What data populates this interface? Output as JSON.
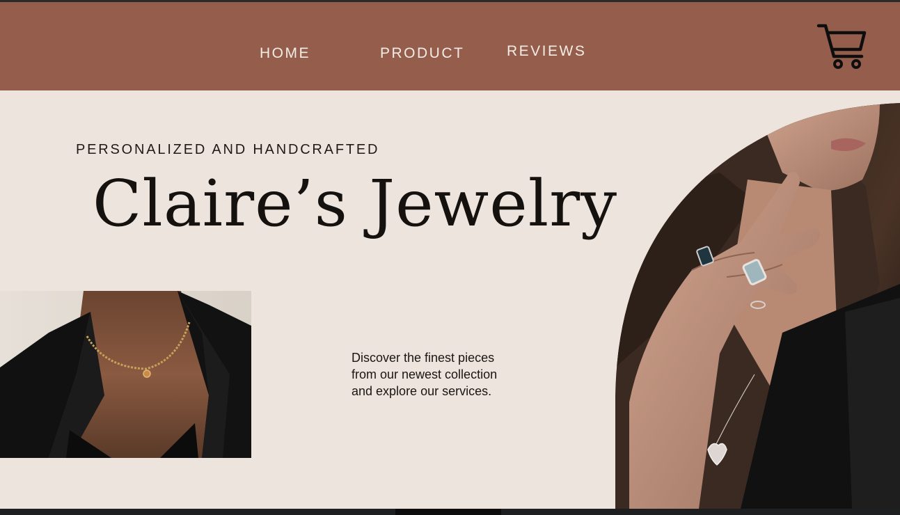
{
  "nav": {
    "items": [
      {
        "label": "HOME"
      },
      {
        "label": "PRODUCT"
      },
      {
        "label": "REVIEWS"
      }
    ],
    "cart_icon": "shopping-cart-icon"
  },
  "hero": {
    "eyebrow": "PERSONALIZED AND HANDCRAFTED",
    "title": "Claire’s Jewelry",
    "description_lines": [
      "Discover the finest pieces",
      "from our newest collection",
      "and explore our services."
    ]
  },
  "colors": {
    "header_bg": "#955e4c",
    "page_bg": "#ede5dd",
    "text_dark": "#15110f",
    "nav_text": "#f5ece6"
  },
  "images": [
    {
      "name": "necklace-photo",
      "subject": "woman wearing gold beaded necklace with black blazer"
    },
    {
      "name": "model-photo",
      "subject": "woman with rings and heart pendant necklace touching her neck"
    }
  ]
}
